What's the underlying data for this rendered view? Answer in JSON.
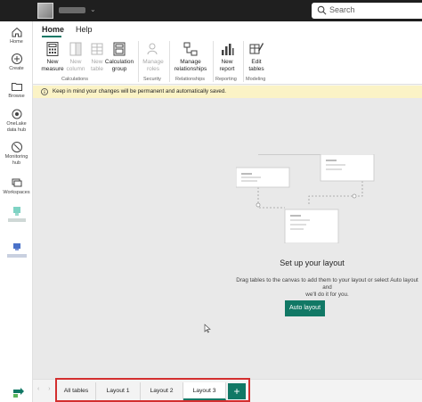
{
  "topbar": {
    "search_placeholder": "Search"
  },
  "rail": {
    "items": [
      {
        "label": "Home",
        "icon": "home-icon"
      },
      {
        "label": "Create",
        "icon": "plus-circle-icon"
      },
      {
        "label": "Browse",
        "icon": "folder-icon"
      },
      {
        "label": "OneLake data hub",
        "label_lines": [
          "OneLake",
          "data hub"
        ],
        "icon": "onelake-icon"
      },
      {
        "label": "Monitoring hub",
        "label_lines": [
          "Monitoring",
          "hub"
        ],
        "icon": "monitoring-icon"
      },
      {
        "label": "Workspaces",
        "icon": "workspaces-icon"
      }
    ]
  },
  "ribbon": {
    "tabs": [
      "Home",
      "Help"
    ],
    "buttons": [
      {
        "label_lines": [
          "New",
          "measure"
        ],
        "disabled": false
      },
      {
        "label_lines": [
          "New",
          "column"
        ],
        "disabled": true
      },
      {
        "label_lines": [
          "New",
          "table"
        ],
        "disabled": true
      },
      {
        "label_lines": [
          "Calculation",
          "group"
        ],
        "disabled": false
      },
      {
        "label_lines": [
          "Manage",
          "roles"
        ],
        "disabled": true
      },
      {
        "label_lines": [
          "Manage",
          "relationships"
        ],
        "disabled": false
      },
      {
        "label_lines": [
          "New",
          "report"
        ],
        "disabled": false
      },
      {
        "label_lines": [
          "Edit",
          "tables"
        ],
        "disabled": false
      }
    ],
    "groups": [
      "Calculations",
      "Security",
      "Relationships",
      "Reporting",
      "Modeling"
    ]
  },
  "infobar": {
    "text": "Keep in mind your changes will be permanent and automatically saved."
  },
  "canvas": {
    "title": "Set up your layout",
    "description_lines": [
      "Drag tables to the canvas to add them to your layout or select Auto layout and",
      "we'll do it for you."
    ],
    "auto_layout_label": "Auto layout"
  },
  "layout_tabs": {
    "tabs": [
      "All tables",
      "Layout 1",
      "Layout 2",
      "Layout 3"
    ],
    "active": "Layout 3",
    "add_label": "+"
  },
  "colors": {
    "accent": "#117865",
    "highlight": "#d32f2f",
    "info_bg": "#fbf3c6"
  }
}
